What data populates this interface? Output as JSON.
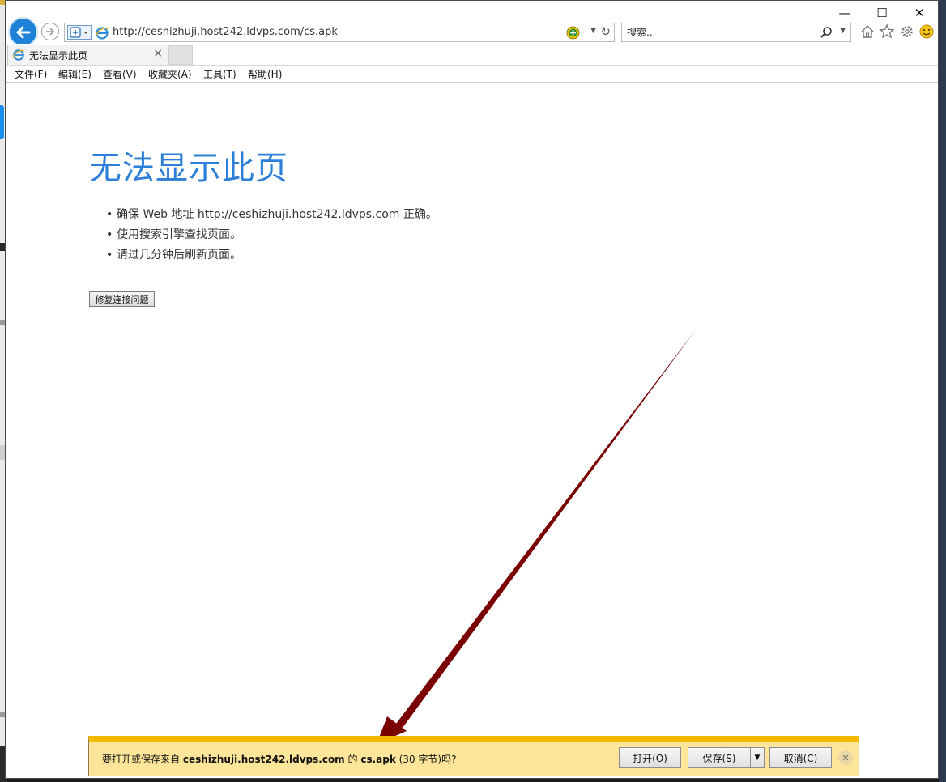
{
  "window": {
    "minimize_glyph": "—",
    "maximize_glyph": "☐",
    "close_glyph": "✕"
  },
  "address_bar": {
    "url": "http://ceshizhuji.host242.ldvps.com/cs.apk"
  },
  "search_bar": {
    "placeholder": "搜索..."
  },
  "toolbar_icons": [
    "home-icon",
    "star-icon",
    "gear-icon",
    "smiley-icon"
  ],
  "tab": {
    "title": "无法显示此页",
    "close_glyph": "×"
  },
  "menu": {
    "file": "文件(F)",
    "edit": "编辑(E)",
    "view": "查看(V)",
    "favorites": "收藏夹(A)",
    "tools": "工具(T)",
    "help": "帮助(H)"
  },
  "error_page": {
    "title": "无法显示此页",
    "tips": [
      "确保 Web 地址 http://ceshizhuji.host242.ldvps.com 正确。",
      "使用搜索引擎查找页面。",
      "请过几分钟后刷新页面。"
    ],
    "fix_button": "修复连接问题"
  },
  "download_bar": {
    "prefix": "要打开或保存来自 ",
    "host": "ceshizhuji.host242.ldvps.com",
    "middle": " 的 ",
    "filename": "cs.apk",
    "suffix": " (30 字节)吗?",
    "open_button": "打开(O)",
    "save_button": "保存(S)",
    "save_dropdown": "▼",
    "cancel_button": "取消(C)",
    "close_glyph": "✕"
  },
  "colors": {
    "accent_blue": "#2d7fd8",
    "notification_bar": "#fde59a",
    "notification_border": "#f3b800",
    "annotation_arrow": "#7a0000"
  }
}
